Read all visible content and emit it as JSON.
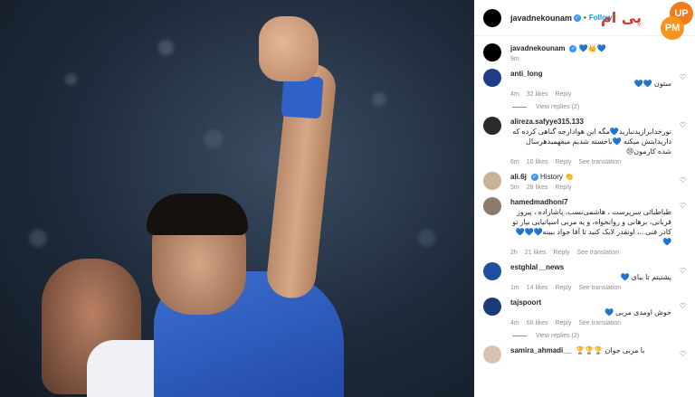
{
  "post": {
    "username": "javadnekounam",
    "follow_label": "Follow",
    "separator": "•",
    "logo_text": "پی ام"
  },
  "badge": {
    "top": "UP",
    "bottom": "PM"
  },
  "caption": {
    "username": "javadnekounam",
    "text": "💙👑💙",
    "time": "9m"
  },
  "comments": [
    {
      "user": "anti_long",
      "text": "ستون 💙💙",
      "rtl": true,
      "time": "4m",
      "likes": "32 likes",
      "reply": "Reply",
      "translate": "",
      "avatar_color": "#1f3c88",
      "view_replies": "View replies (2)"
    },
    {
      "user": "alireza.safyye315.133",
      "text": "نورخدابرازیدنبارید💙مگه این هوادارجه گناهی کرده که داریدایتش میکنه 💙باخسته شدیم میفهمیدهرسال شده کارمون😢",
      "rtl": true,
      "time": "6m",
      "likes": "10 likes",
      "reply": "Reply",
      "translate": "See translation",
      "avatar_color": "#2b2b2b",
      "view_replies": ""
    },
    {
      "user": "ali.6j",
      "text": "History 👏",
      "rtl": false,
      "time": "5m",
      "likes": "28 likes",
      "reply": "Reply",
      "translate": "",
      "avatar_color": "#c9b39a",
      "view_replies": ""
    },
    {
      "user": "hamedmadhoni7",
      "text": "طباطبائی سرپرست ، هاشمی‌نسب، پاشازاده ، پیروز قربانی، برهانی و روانخواه، و یه مربی اسپانیایی بیار تو کادر فنی...، اونقدر لایک کنید تا آقا جواد ببینه💙💙💙💙",
      "rtl": true,
      "time": "2h",
      "likes": "21 likes",
      "reply": "Reply",
      "translate": "See translation",
      "avatar_color": "#8c7b6a",
      "view_replies": ""
    },
    {
      "user": "estghlal__news",
      "text": "پشتیتم تا بیای 💙",
      "rtl": true,
      "time": "1m",
      "likes": "14 likes",
      "reply": "Reply",
      "translate": "See translation",
      "avatar_color": "#1e4fa0",
      "view_replies": ""
    },
    {
      "user": "tajspoort",
      "text": "خوش اومدی مربی 💙",
      "rtl": true,
      "time": "4m",
      "likes": "66 likes",
      "reply": "Reply",
      "translate": "See translation",
      "avatar_color": "#1a3a7a",
      "view_replies": "View replies (2)"
    },
    {
      "user": "samira_ahmadi__",
      "text": "🏆🏆🏆 با مربی جوان",
      "rtl": false,
      "time": "",
      "likes": "",
      "reply": "",
      "translate": "",
      "avatar_color": "#d9c2b0",
      "view_replies": ""
    }
  ],
  "icons": {
    "heart": "heart-icon",
    "verified": "verified-icon",
    "avatar": "avatar"
  }
}
